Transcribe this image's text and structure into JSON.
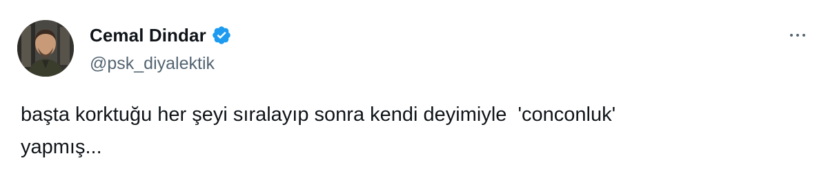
{
  "author": {
    "display_name": "Cemal Dindar",
    "handle": "@psk_diyalektik",
    "verified": true,
    "avatar_icon": "profile-photo"
  },
  "tweet": {
    "text_line1": "başta korktuğu her şeyi sıralayıp sonra kendi deyimiyle  'conconluk'",
    "text_line2": "yapmış..."
  },
  "menu": {
    "icon": "more-options-icon"
  },
  "colors": {
    "verified_blue": "#1d9bf0",
    "text_primary": "#0f1419",
    "text_secondary": "#536471"
  }
}
